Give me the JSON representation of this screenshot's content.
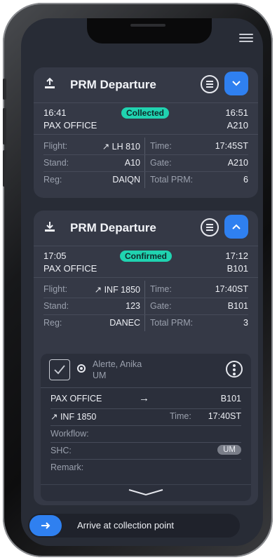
{
  "cards": [
    {
      "title": "PRM Departure",
      "icon": "upload-icon",
      "start_time": "16:41",
      "end_time": "16:51",
      "origin": "PAX OFFICE",
      "destination": "A210",
      "status": "Collected",
      "flight_label": "Flight:",
      "flight": "↗ LH 810",
      "time_label": "Time:",
      "time": "17:45ST",
      "stand_label": "Stand:",
      "stand": "A10",
      "gate_label": "Gate:",
      "gate": "A210",
      "reg_label": "Reg:",
      "reg": "DAIQN",
      "total_label": "Total PRM:",
      "total": "6",
      "expanded": false
    },
    {
      "title": "PRM Departure",
      "icon": "download-icon",
      "start_time": "17:05",
      "end_time": "17:12",
      "origin": "PAX OFFICE",
      "destination": "B101",
      "status": "Confirmed",
      "flight_label": "Flight:",
      "flight": "↗ INF 1850",
      "time_label": "Time:",
      "time": "17:40ST",
      "stand_label": "Stand:",
      "stand": "123",
      "gate_label": "Gate:",
      "gate": "B101",
      "reg_label": "Reg:",
      "reg": "DANEC",
      "total_label": "Total PRM:",
      "total": "3",
      "expanded": true
    }
  ],
  "passenger": {
    "name": "Alerte, Anika",
    "type": "UM",
    "from": "PAX OFFICE",
    "arrow": "→",
    "to": "B101",
    "flight": "↗ INF 1850",
    "time_label": "Time:",
    "time": "17:40ST",
    "workflow_label": "Workflow:",
    "shc_label": "SHC:",
    "shc_value": "UM",
    "remark_label": "Remark:"
  },
  "action": {
    "label": "Arrive at collection point"
  },
  "colors": {
    "accent": "#2f80f0",
    "status_badge": "#20d3b0",
    "background": "#282c36",
    "card": "#353946"
  }
}
